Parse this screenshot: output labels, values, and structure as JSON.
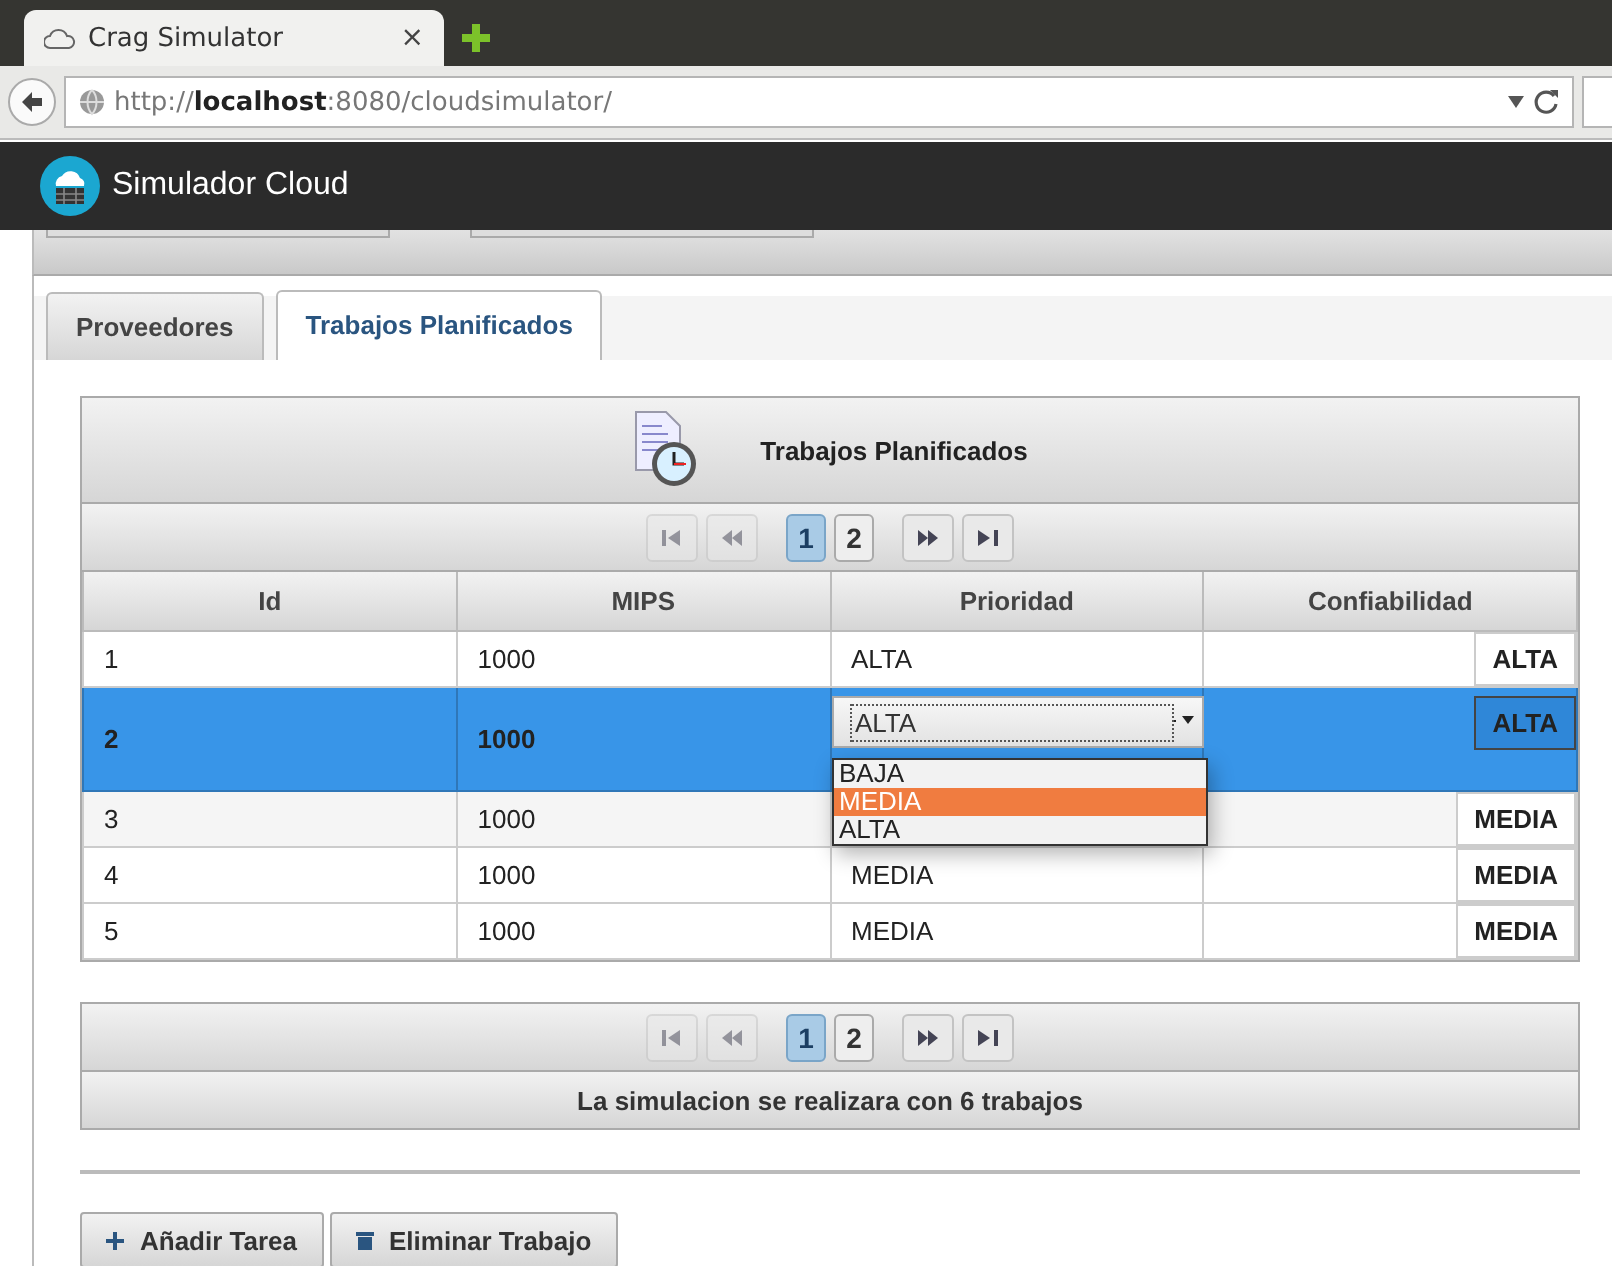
{
  "browser": {
    "tab_title": "Crag Simulator",
    "close": "×",
    "url": "http://**localhost**:8080/cloudsimulator/"
  },
  "app": {
    "title": "Simulador Cloud"
  },
  "tabs": [
    {
      "label": "Proveedores",
      "selected": false
    },
    {
      "label": "Trabajos Planificados",
      "selected": true
    }
  ],
  "panel": {
    "title": "Trabajos Planificados"
  },
  "paginator_top": {
    "pages": [
      {
        "label": "1",
        "selected": true
      },
      {
        "label": "2",
        "selected": false
      }
    ]
  },
  "table": {
    "columns": [
      "Id",
      "MIPS",
      "Prioridad",
      "Confiabilidad"
    ],
    "rows": [
      {
        "id": "1",
        "mips": "1000",
        "prioridad": "ALTA",
        "confiabilidad": "ALTA",
        "selected": false
      },
      {
        "id": "2",
        "mips": "1000",
        "prioridad": "ALTA",
        "confiabilidad": "ALTA",
        "selected": true,
        "dropdown": [
          {
            "label": "BAJA",
            "selected": false
          },
          {
            "label": "MEDIA",
            "selected": true
          },
          {
            "label": "ALTA",
            "selected": false
          }
        ]
      },
      {
        "id": "3",
        "mips": "1000",
        "confiabilidad": "MEDIA",
        "selected": false
      },
      {
        "id": "4",
        "mips": "1000",
        "prioridad": "MEDIA",
        "confiabilidad": "MEDIA",
        "selected": false
      },
      {
        "id": "5",
        "mips": "1000",
        "prioridad": "MEDIA",
        "confiabilidad": "MEDIA",
        "selected": false
      }
    ]
  },
  "paginator_bottom": {
    "pages": [
      {
        "label": "1",
        "selected": true
      },
      {
        "label": "2",
        "selected": false
      }
    ]
  },
  "footer": "La simulacion se realizara con 6 trabajos",
  "buttons": [
    {
      "kind": "add",
      "label": "Añadir Tarea"
    },
    {
      "kind": "delete",
      "label": "Eliminar Trabajo"
    }
  ]
}
